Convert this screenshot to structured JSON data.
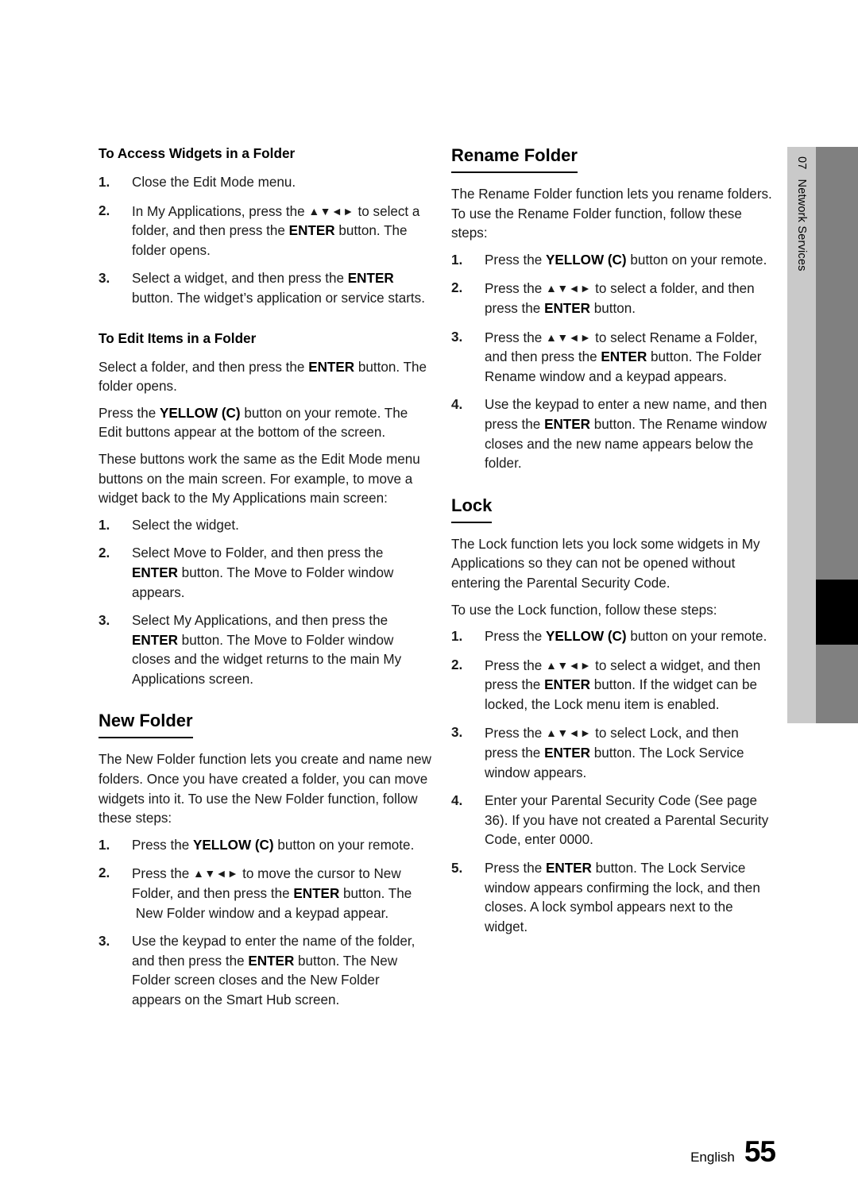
{
  "document": {
    "chapter_tab": {
      "number": "07",
      "label": "Network Services"
    },
    "footer": {
      "language": "English",
      "page_number": "55"
    }
  },
  "left_column": {
    "access_widgets": {
      "heading": "To Access Widgets in a Folder",
      "steps": [
        {
          "num": "1.",
          "text": "Close the Edit Mode menu."
        },
        {
          "num": "2.",
          "text": "In My Applications, press the ▲▼◄► to select a folder, and then press the ENTER button. The folder opens."
        },
        {
          "num": "3.",
          "text": "Select a widget, and then press the ENTER button. The widget’s application or service starts."
        }
      ]
    },
    "edit_items": {
      "heading": "To Edit Items in a Folder",
      "paragraphs": [
        "Select a folder, and then press the ENTER button. The folder opens.",
        "Press the YELLOW (C) button on your remote. The Edit buttons appear at the bottom of the screen.",
        "These buttons work the same as the Edit Mode menu buttons on the main screen. For example, to move a widget back to the My Applications main screen:"
      ],
      "steps": [
        {
          "num": "1.",
          "text": "Select the widget."
        },
        {
          "num": "2.",
          "text": "Select Move to Folder, and then press the ENTER button. The Move to Folder window appears."
        },
        {
          "num": "3.",
          "text": "Select My Applications, and then press the ENTER button. The Move to Folder window closes and the widget returns to the main My Applications screen."
        }
      ]
    },
    "new_folder": {
      "heading": "New Folder",
      "intro": "The New Folder function lets you create and name new folders. Once you have created a folder, you can move widgets into it. To use the New Folder function, follow these steps:",
      "steps": [
        {
          "num": "1.",
          "text": "Press the YELLOW (C) button on your remote."
        },
        {
          "num": "2.",
          "text": "Press the ▲▼◄► to move the cursor to New Folder, and then press the ENTER button. The  New Folder window and a keypad appear."
        },
        {
          "num": "3.",
          "text": "Use the keypad to enter the name of the folder, and then press the ENTER button. The New Folder screen closes and the New Folder appears on the Smart Hub screen."
        }
      ]
    }
  },
  "right_column": {
    "rename_folder": {
      "heading": "Rename Folder",
      "intro": "The Rename Folder function lets you rename folders. To use the Rename Folder function, follow these steps:",
      "steps": [
        {
          "num": "1.",
          "text": "Press the YELLOW (C) button on your remote."
        },
        {
          "num": "2.",
          "text": "Press the ▲▼◄► to select a folder, and then press the ENTER button."
        },
        {
          "num": "3.",
          "text": "Press the ▲▼◄► to select Rename a Folder, and then press the ENTER button. The Folder Rename window and a keypad appears."
        },
        {
          "num": "4.",
          "text": "Use the keypad to enter a new name, and then press the ENTER button. The Rename window closes and the new name appears below the folder."
        }
      ]
    },
    "lock": {
      "heading": "Lock",
      "intro_1": "The Lock function lets you lock some widgets in My Applications so they can not be opened without entering the Parental Security Code.",
      "intro_2": "To use the Lock function, follow these steps:",
      "steps": [
        {
          "num": "1.",
          "text": "Press the YELLOW (C) button on your remote."
        },
        {
          "num": "2.",
          "text": "Press the ▲▼◄► to select a widget, and then press the ENTER button. If the widget can be locked, the Lock menu item is enabled."
        },
        {
          "num": "3.",
          "text": "Press the ▲▼◄► to select Lock, and then press the ENTER button. The Lock Service window appears."
        },
        {
          "num": "4.",
          "text": "Enter your Parental Security Code (See page 36). If you have not created a Parental Security Code, enter 0000."
        },
        {
          "num": "5.",
          "text": "Press the ENTER button. The Lock Service window appears confirming the lock, and then closes. A lock symbol appears next to the widget."
        }
      ]
    }
  }
}
